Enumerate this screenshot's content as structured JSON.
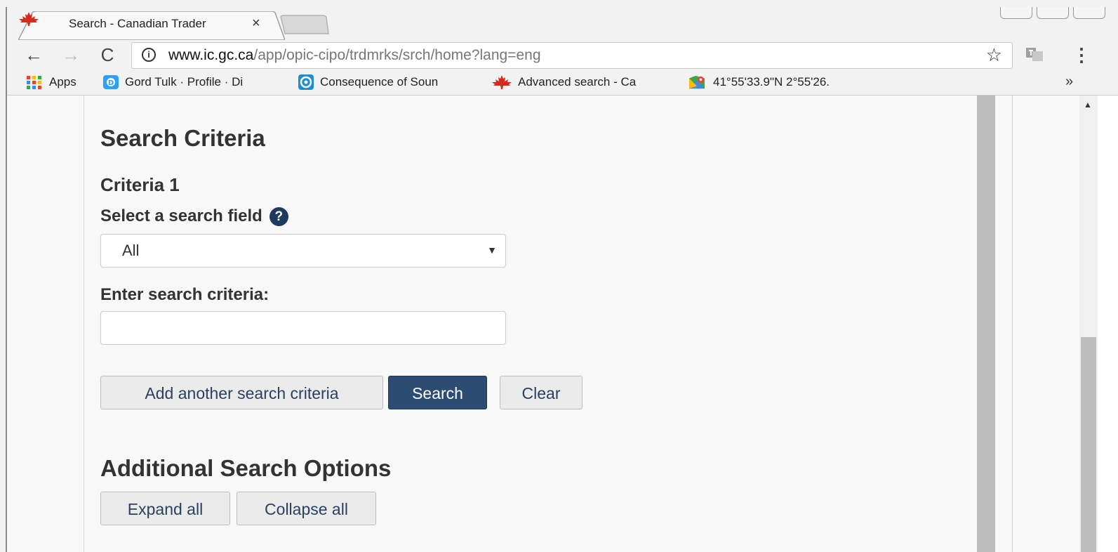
{
  "browser": {
    "tab": {
      "title": "Search - Canadian Trader",
      "close_glyph": "×",
      "favicon": "maple-leaf-icon"
    },
    "nav": {
      "back": "←",
      "forward": "→",
      "reload": "C"
    },
    "omnibox": {
      "info_glyph": "i",
      "url_host": "www.ic.gc.ca",
      "url_path": "/app/opic-cipo/trdmrks/srch/home?lang=eng",
      "star_glyph": "☆"
    },
    "menu_glyph": "⋮",
    "bookmarks": [
      {
        "label": "Apps",
        "icon": "apps-grid-icon"
      },
      {
        "label": "Gord Tulk · Profile · Di",
        "icon": "disqus-icon"
      },
      {
        "label": "Consequence of Soun",
        "icon": "consequence-icon"
      },
      {
        "label": "Advanced search - Ca",
        "icon": "maple-leaf-icon"
      },
      {
        "label": "41°55'33.9\"N 2°55'26.",
        "icon": "maps-icon"
      }
    ],
    "bookmarks_more": "»"
  },
  "colors": {
    "primary_button": "#2d4c74",
    "help_icon": "#1f3a5f",
    "maple_red": "#d52b1e"
  },
  "page": {
    "section_title": "Search Criteria",
    "criteria_title": "Criteria 1",
    "select_label": "Select a search field",
    "help_glyph": "?",
    "select_value": "All",
    "select_caret": "▼",
    "criteria_label": "Enter search criteria:",
    "criteria_value": "",
    "buttons": {
      "add": "Add another search criteria",
      "search": "Search",
      "clear": "Clear"
    },
    "options_title": "Additional Search Options",
    "options_buttons": {
      "expand": "Expand all",
      "collapse": "Collapse all"
    },
    "scroll_up_glyph": "▲"
  }
}
